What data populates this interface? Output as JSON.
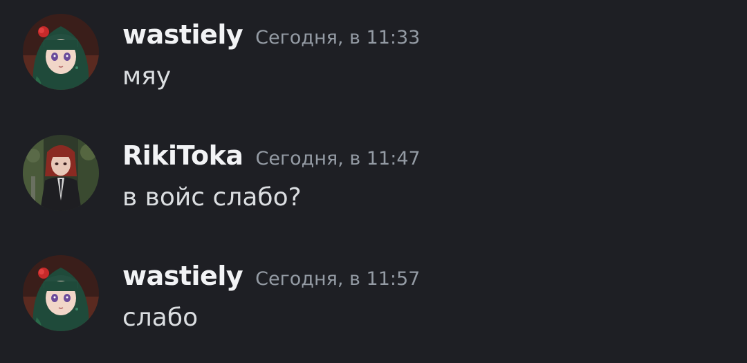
{
  "messages": [
    {
      "author": "wastiely",
      "timestamp": "Сегодня, в 11:33",
      "text": "мяу",
      "avatar_icon": "green-hair-girl-avatar"
    },
    {
      "author": "RikiToka",
      "timestamp": "Сегодня, в 11:47",
      "text": "в войс слабо?",
      "avatar_icon": "red-hair-suit-avatar"
    },
    {
      "author": "wastiely",
      "timestamp": "Сегодня, в 11:57",
      "text": "слабо",
      "avatar_icon": "green-hair-girl-avatar"
    }
  ],
  "colors": {
    "background": "#1e1f24",
    "username": "#f2f3f5",
    "timestamp": "#949ba4",
    "message_text": "#dbdee1"
  }
}
